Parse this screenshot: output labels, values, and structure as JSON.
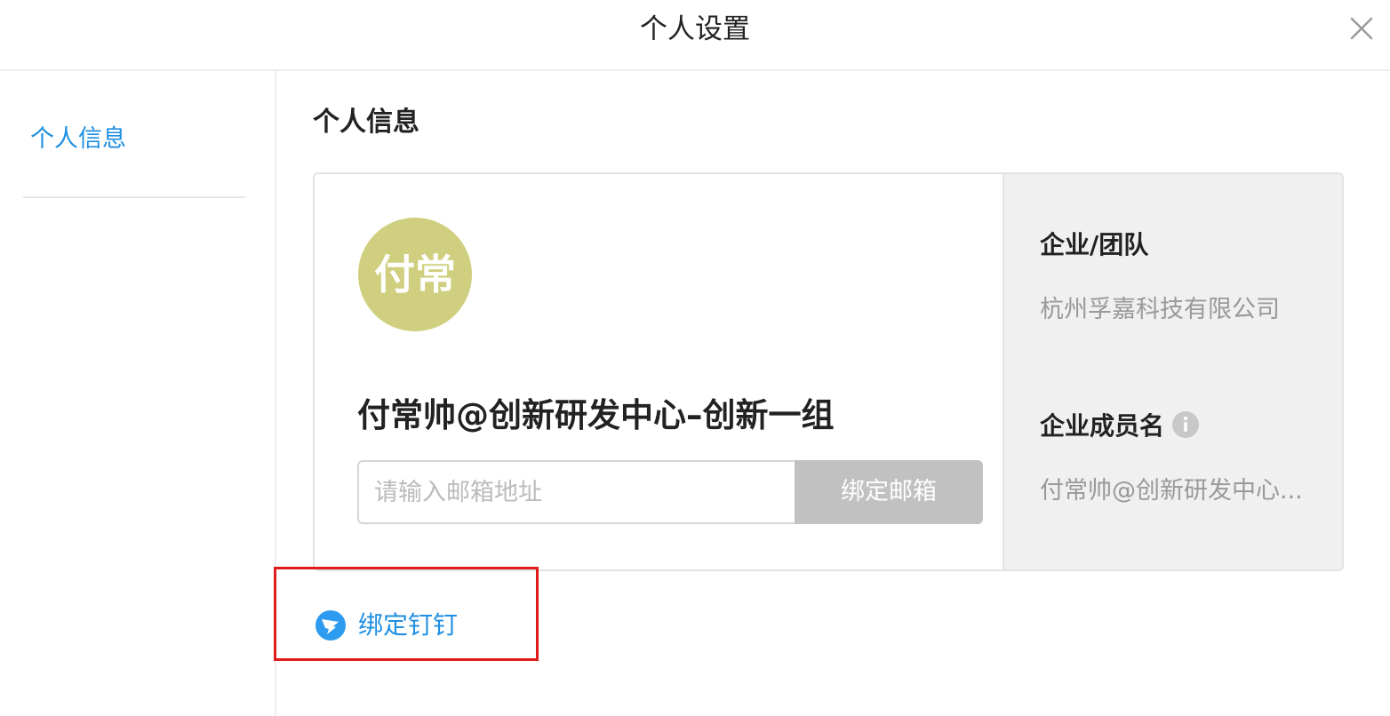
{
  "header": {
    "title": "个人设置"
  },
  "sidebar": {
    "items": [
      {
        "label": "个人信息"
      }
    ]
  },
  "main": {
    "section_title": "个人信息",
    "profile": {
      "avatar_text": "付常",
      "avatar_color": "#cfcf7f",
      "display_name": "付常帅@创新研发中心–创新一组",
      "email_placeholder": "请输入邮箱地址",
      "bind_email_label": "绑定邮箱"
    },
    "company": {
      "team_label": "企业/团队",
      "team_value": "杭州孚嘉科技有限公司",
      "member_name_label": "企业成员名",
      "member_name_value": "付常帅@创新研发中心..."
    },
    "bind_dingtalk_label": "绑定钉钉"
  },
  "colors": {
    "accent": "#1e8fe1",
    "highlight": "#e01b1b"
  }
}
